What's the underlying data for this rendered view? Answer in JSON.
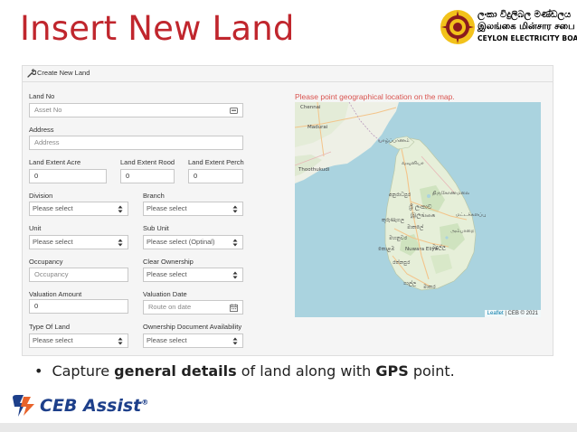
{
  "slide": {
    "title": "Insert New Land",
    "bullet_prefix": "Capture ",
    "bullet_bold1": "general details",
    "bullet_mid": " of land along with ",
    "bullet_bold2": "GPS",
    "bullet_suffix": " point."
  },
  "logo": {
    "line1": "ලංකා විදුලිබල මණ්ඩලය",
    "line2": "இலங்கை மின்சார சபை",
    "line3": "CEYLON ELECTRICITY BOARD"
  },
  "footer": {
    "brand": "CEB Assist",
    "registered": "®"
  },
  "panel": {
    "title": "Create New Land"
  },
  "form": {
    "asset_no": {
      "label": "Land No",
      "placeholder": "Asset No"
    },
    "address": {
      "label": "Address",
      "placeholder": "Address"
    },
    "extent_acre": {
      "label": "Land Extent Acre",
      "value": "0"
    },
    "extent_rood": {
      "label": "Land Extent Rood",
      "value": "0"
    },
    "extent_perch": {
      "label": "Land Extent Perch",
      "value": "0"
    },
    "division": {
      "label": "Division",
      "value": "Please select"
    },
    "branch": {
      "label": "Branch",
      "value": "Please select"
    },
    "unit": {
      "label": "Unit",
      "value": "Please select"
    },
    "sub_unit": {
      "label": "Sub Unit",
      "value": "Please select (Optinal)"
    },
    "occupancy": {
      "label": "Occupancy",
      "placeholder": "Occupancy"
    },
    "clear_ownership": {
      "label": "Clear Ownership",
      "value": "Please select"
    },
    "valuation_amount": {
      "label": "Valuation Amount",
      "value": "0"
    },
    "valuation_date": {
      "label": "Valuation Date",
      "placeholder": "Route on date"
    },
    "type_of_land": {
      "label": "Type Of Land",
      "value": "Please select"
    },
    "ownership_doc": {
      "label": "Ownership Document Availability",
      "value": "Please select"
    }
  },
  "map": {
    "caption": "Please point geographical location on the map.",
    "attribution_link": "Leaflet",
    "attribution_text": " | CEB © 2021",
    "labels": {
      "chennai": "Chennai",
      "madurai": "Madurai",
      "jaffna": "யாழ்ப்பாணம்",
      "vavuniya": "வவுனியா",
      "thoothukudi": "Thoothukudi",
      "anuradhapura": "අනුරාධපුර",
      "trinco": "திருகோணமலை",
      "sri_lanka": "ශ්‍රී ලංකාව",
      "sri_lanka_ta": "இලங்கை",
      "kurunegala": "කුරුණෑගල",
      "matale": "මාතලේ",
      "colombo": "කොළඹ",
      "kandy": "මහනුවර",
      "nuwara": "Nuwara Eliya",
      "ratnapura": "රත්නපුර",
      "galle": "ගාල්ල",
      "matara": "මාතර",
      "batticaloa": "மட்டக்களப்பு",
      "ampara": "அம்பாறை",
      "badulla": "බදුල්ල"
    }
  }
}
